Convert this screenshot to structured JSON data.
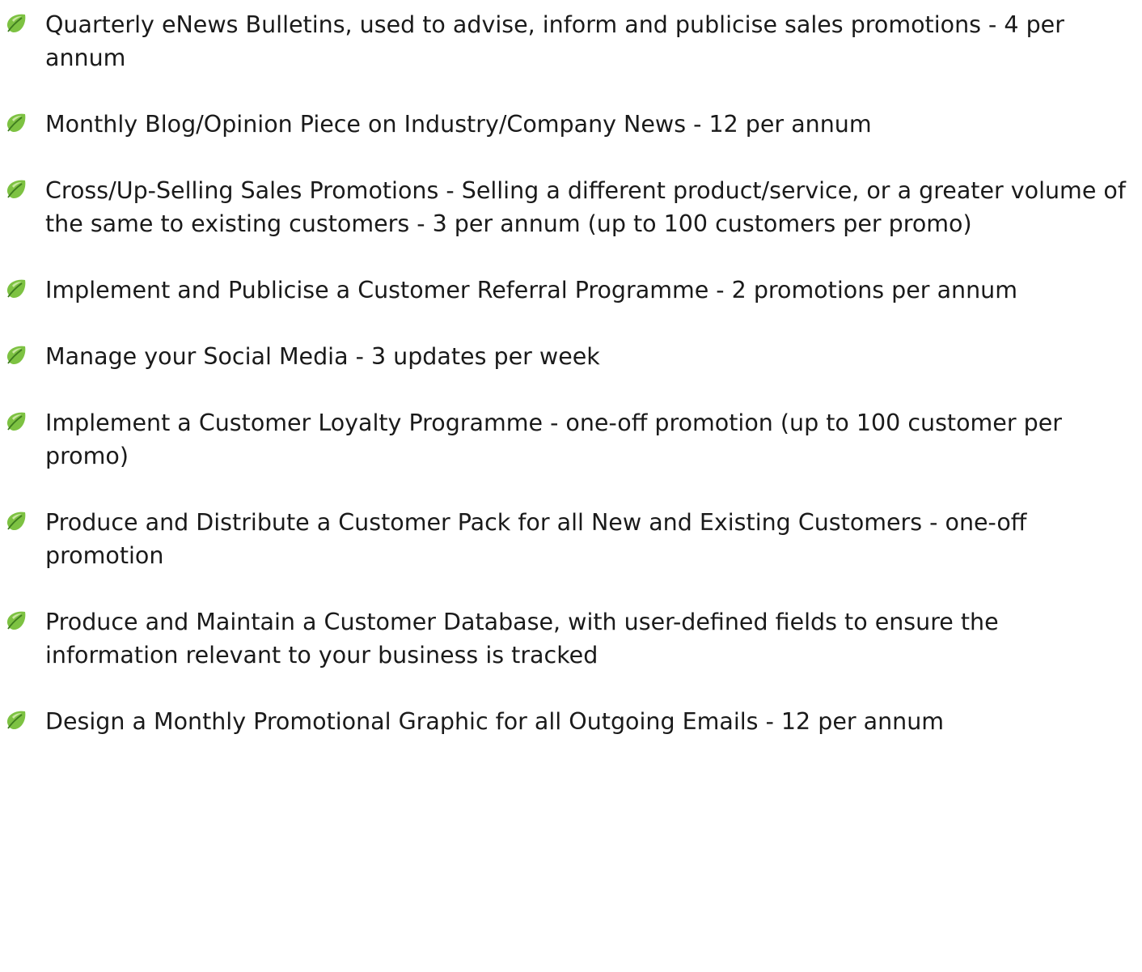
{
  "bullet_icon": "green-leaf-bullet-icon",
  "accent_color": "#7dc242",
  "items": [
    {
      "text": "Quarterly eNews Bulletins, used to advise, inform and publicise sales promotions - 4 per annum"
    },
    {
      "text": "Monthly Blog/Opinion Piece on Industry/Company News - 12 per annum"
    },
    {
      "text": "Cross/Up-Selling Sales Promotions - Selling a different product/service, or a greater volume of the same to existing customers - 3 per annum (up to 100 customers per promo)"
    },
    {
      "text": "Implement and Publicise a Customer Referral Programme - 2 promotions per annum"
    },
    {
      "text": "Manage your Social Media - 3 updates per week"
    },
    {
      "text": "Implement a Customer Loyalty Programme - one-off promotion (up to 100 customer per promo)"
    },
    {
      "text": "Produce and Distribute a Customer Pack for all New and Existing Customers - one-off promotion"
    },
    {
      "text": "Produce and Maintain a Customer Database, with user-defined fields to ensure the information relevant to your business is tracked"
    },
    {
      "text": "Design a Monthly Promotional Graphic for all Outgoing Emails - 12 per annum"
    }
  ]
}
